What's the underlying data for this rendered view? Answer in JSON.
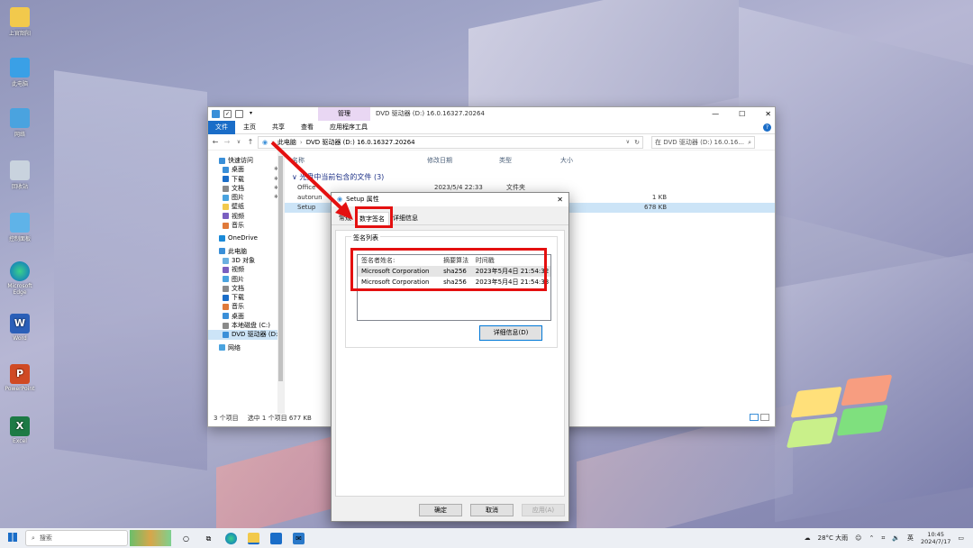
{
  "desktop_icons": [
    {
      "label": "上官韶阳",
      "name": "user-folder"
    },
    {
      "label": "此电脑",
      "name": "this-pc"
    },
    {
      "label": "网络",
      "name": "network"
    },
    {
      "label": "回收站",
      "name": "recycle-bin"
    },
    {
      "label": "控制面板",
      "name": "control-panel"
    },
    {
      "label": "Microsoft Edge",
      "name": "edge"
    },
    {
      "label": "Word",
      "name": "word"
    },
    {
      "label": "PowerPoint",
      "name": "powerpoint"
    },
    {
      "label": "Excel",
      "name": "excel"
    }
  ],
  "explorer": {
    "manage_tab": "管理",
    "title": "DVD 驱动器 (D:) 16.0.16327.20264",
    "ribbon": {
      "file": "文件",
      "home": "主页",
      "share": "共享",
      "view": "查看",
      "app_tools": "应用程序工具"
    },
    "breadcrumb": [
      "此电脑",
      "DVD 驱动器 (D:) 16.0.16327.20264"
    ],
    "search_placeholder": "在 DVD 驱动器 (D:) 16.0.16...",
    "nav": [
      {
        "label": "快速访问",
        "pinned": false
      },
      {
        "label": "桌面",
        "pinned": true
      },
      {
        "label": "下载",
        "pinned": true
      },
      {
        "label": "文档",
        "pinned": true
      },
      {
        "label": "图片",
        "pinned": true
      },
      {
        "label": "壁纸",
        "pinned": false
      },
      {
        "label": "视频",
        "pinned": false
      },
      {
        "label": "音乐",
        "pinned": false
      },
      {
        "label": "OneDrive",
        "pinned": false
      },
      {
        "label": "此电脑",
        "pinned": false
      },
      {
        "label": "3D 对象",
        "pinned": false
      },
      {
        "label": "视频",
        "pinned": false
      },
      {
        "label": "图片",
        "pinned": false
      },
      {
        "label": "文档",
        "pinned": false
      },
      {
        "label": "下载",
        "pinned": false
      },
      {
        "label": "音乐",
        "pinned": false
      },
      {
        "label": "桌面",
        "pinned": false
      },
      {
        "label": "本地磁盘 (C:)",
        "pinned": false
      },
      {
        "label": "DVD 驱动器 (D:)",
        "pinned": false
      },
      {
        "label": "网络",
        "pinned": false
      }
    ],
    "columns": {
      "name": "名称",
      "modified": "修改日期",
      "type": "类型",
      "size": "大小"
    },
    "group_header": "光盘中当前包含的文件 (3)",
    "files": [
      {
        "name": "Office",
        "modified": "2023/5/4 22:33",
        "type": "文件夹",
        "size": ""
      },
      {
        "name": "autorun",
        "modified": "",
        "type": "",
        "size": "1 KB"
      },
      {
        "name": "Setup",
        "modified": "",
        "type": "",
        "size": "678 KB"
      }
    ],
    "status": {
      "count": "3 个项目",
      "selected": "选中 1 个项目  677 KB"
    }
  },
  "dialog": {
    "title": "Setup 属性",
    "tabs": [
      "常规",
      "数字签名",
      "详细信息"
    ],
    "active_tab": "数字签名",
    "group_label": "签名列表",
    "list_headers": {
      "signer": "签名者姓名:",
      "algorithm": "摘要算法",
      "timestamp": "时间戳"
    },
    "signatures": [
      {
        "signer": "Microsoft Corporation",
        "algorithm": "sha256",
        "timestamp": "2023年5月4日 21:54:32"
      },
      {
        "signer": "Microsoft Corporation",
        "algorithm": "sha256",
        "timestamp": "2023年5月4日 21:54:33"
      }
    ],
    "details_button": "详细信息(D)",
    "ok": "确定",
    "cancel": "取消",
    "apply": "应用(A)"
  },
  "taskbar": {
    "search": "搜索",
    "weather": "28°C  大雨",
    "ime": "英",
    "time": "10:45",
    "date": "2024/7/17"
  },
  "colors": {
    "accent": "#1a6dc8",
    "annotation": "#e41010",
    "selection": "#cce4f7"
  }
}
